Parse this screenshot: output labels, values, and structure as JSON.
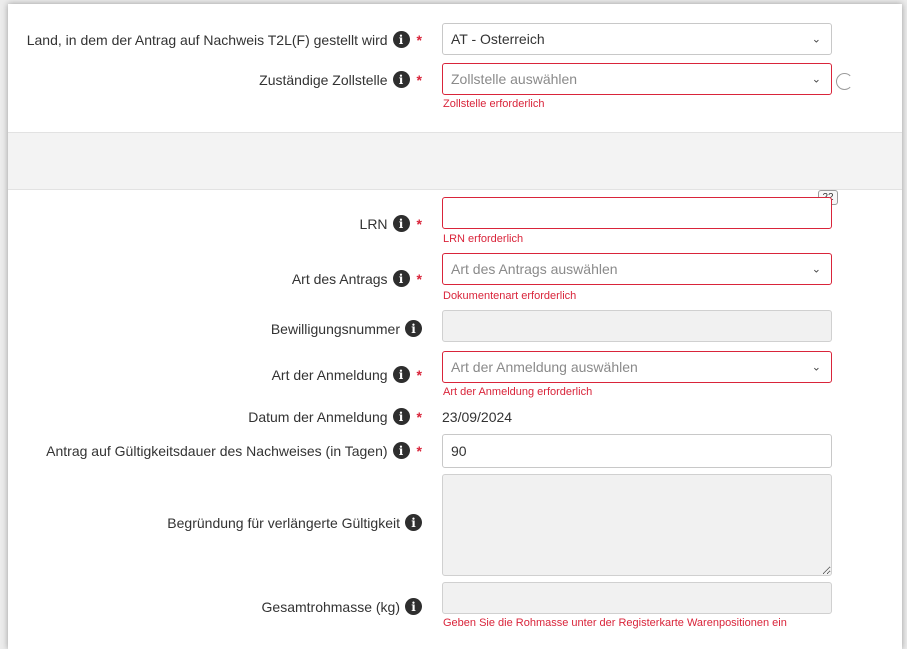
{
  "form": {
    "country": {
      "label": "Land, in dem der Antrag auf Nachweis T2L(F) gestellt wird",
      "required_mark": "*",
      "value": "AT - Osterreich"
    },
    "customs_office": {
      "label": "Zuständige Zollstelle",
      "required_mark": "*",
      "placeholder": "Zollstelle auswählen",
      "error": "Zollstelle erforderlich"
    },
    "lrn": {
      "label": "LRN",
      "required_mark": "*",
      "counter": "22",
      "error": "LRN erforderlich"
    },
    "application_type": {
      "label": "Art des Antrags",
      "required_mark": "*",
      "placeholder": "Art des Antrags auswählen",
      "error": "Dokumentenart erforderlich"
    },
    "authorization_number": {
      "label": "Bewilligungsnummer"
    },
    "declaration_type": {
      "label": "Art der Anmeldung",
      "required_mark": "*",
      "placeholder": "Art der Anmeldung auswählen",
      "error": "Art der Anmeldung erforderlich"
    },
    "declaration_date": {
      "label": "Datum der Anmeldung",
      "required_mark": "*",
      "value": "23/09/2024"
    },
    "validity_period": {
      "label": "Antrag auf Gültigkeitsdauer des Nachweises (in Tagen)",
      "required_mark": "*",
      "value": "90"
    },
    "extended_validity_reason": {
      "label": "Begründung für verlängerte Gültigkeit"
    },
    "gross_mass": {
      "label": "Gesamtrohmasse (kg)",
      "error": "Geben Sie die Rohmasse unter der Registerkarte Warenpositionen ein"
    }
  },
  "icons": {
    "info": "info-circle-icon",
    "chevron": "chevron-down-icon",
    "spinner": "loading-spinner-icon"
  },
  "colors": {
    "error": "#d9243a",
    "info_icon": "#2e2e2e",
    "disabled_field": "#f1f1f1"
  }
}
